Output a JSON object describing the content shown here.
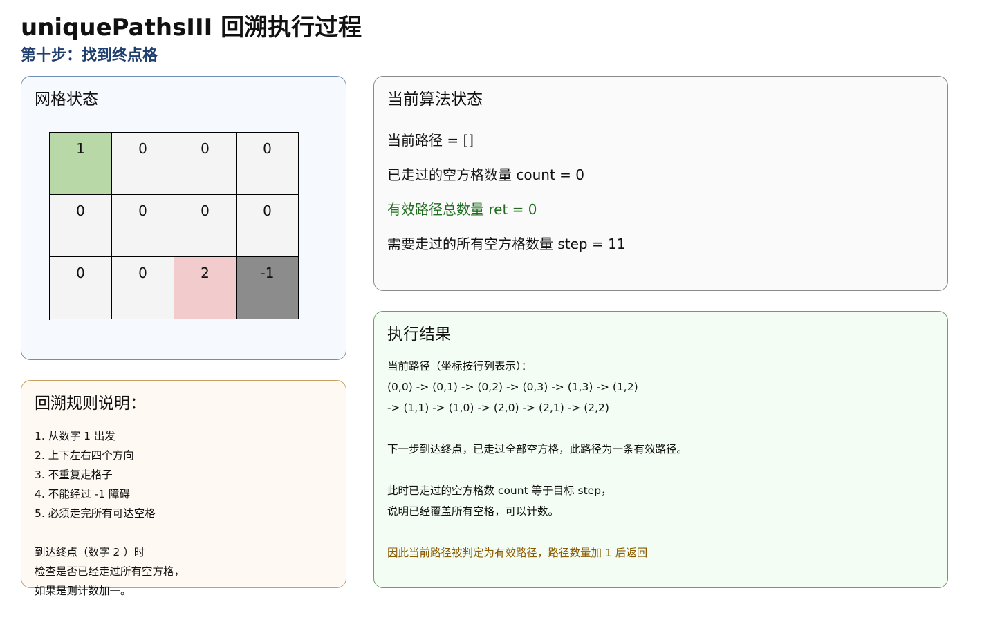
{
  "header": {
    "title": "uniquePathsIII 回溯执行过程",
    "subtitle": "第十步：找到终点格"
  },
  "grid_panel": {
    "title": "网格状态",
    "cells": [
      [
        "1",
        "0",
        "0",
        "0"
      ],
      [
        "0",
        "0",
        "0",
        "0"
      ],
      [
        "0",
        "0",
        "2",
        "-1"
      ]
    ],
    "cell_colors": {
      "start": "#b8d8a8",
      "empty": "#f4f4f4",
      "end": "#f2cccc",
      "obstacle": "#8c8c8c"
    }
  },
  "state_panel": {
    "title": "当前算法状态",
    "lines": [
      "当前路径 = []",
      "已走过的空方格数量 count = 0",
      "有效路径总数量 ret = 0",
      "需要走过的所有空方格数量 step = 11"
    ],
    "highlight_color": "#1f6e1f"
  },
  "rules_panel": {
    "title": "回溯规则说明：",
    "lines": [
      "1. 从数字 1 出发",
      "2. 上下左右四个方向",
      "3. 不重复走格子",
      "4. 不能经过 -1 障碍",
      "5. 必须走完所有可达空格",
      "",
      "到达终点（数字 2 ）时",
      "检查是否已经走过所有空方格，",
      "如果是则计数加一。"
    ]
  },
  "result_panel": {
    "title": "执行结果",
    "lines": [
      "当前路径（坐标按行列表示）：",
      "(0,0) -> (0,1) -> (0,2) -> (0,3) -> (1,3) -> (1,2)",
      "-> (1,1) -> (1,0) -> (2,0) -> (2,1) -> (2,2)",
      "",
      "下一步到达终点，已走过全部空方格，此路径为一条有效路径。",
      "",
      "此时已走过的空方格数 count 等于目标 step，",
      "说明已经覆盖所有空格，可以计数。",
      "",
      "因此当前路径被判定为有效路径，路径数量加 1 后返回"
    ],
    "note_color": "#8a5a00"
  }
}
